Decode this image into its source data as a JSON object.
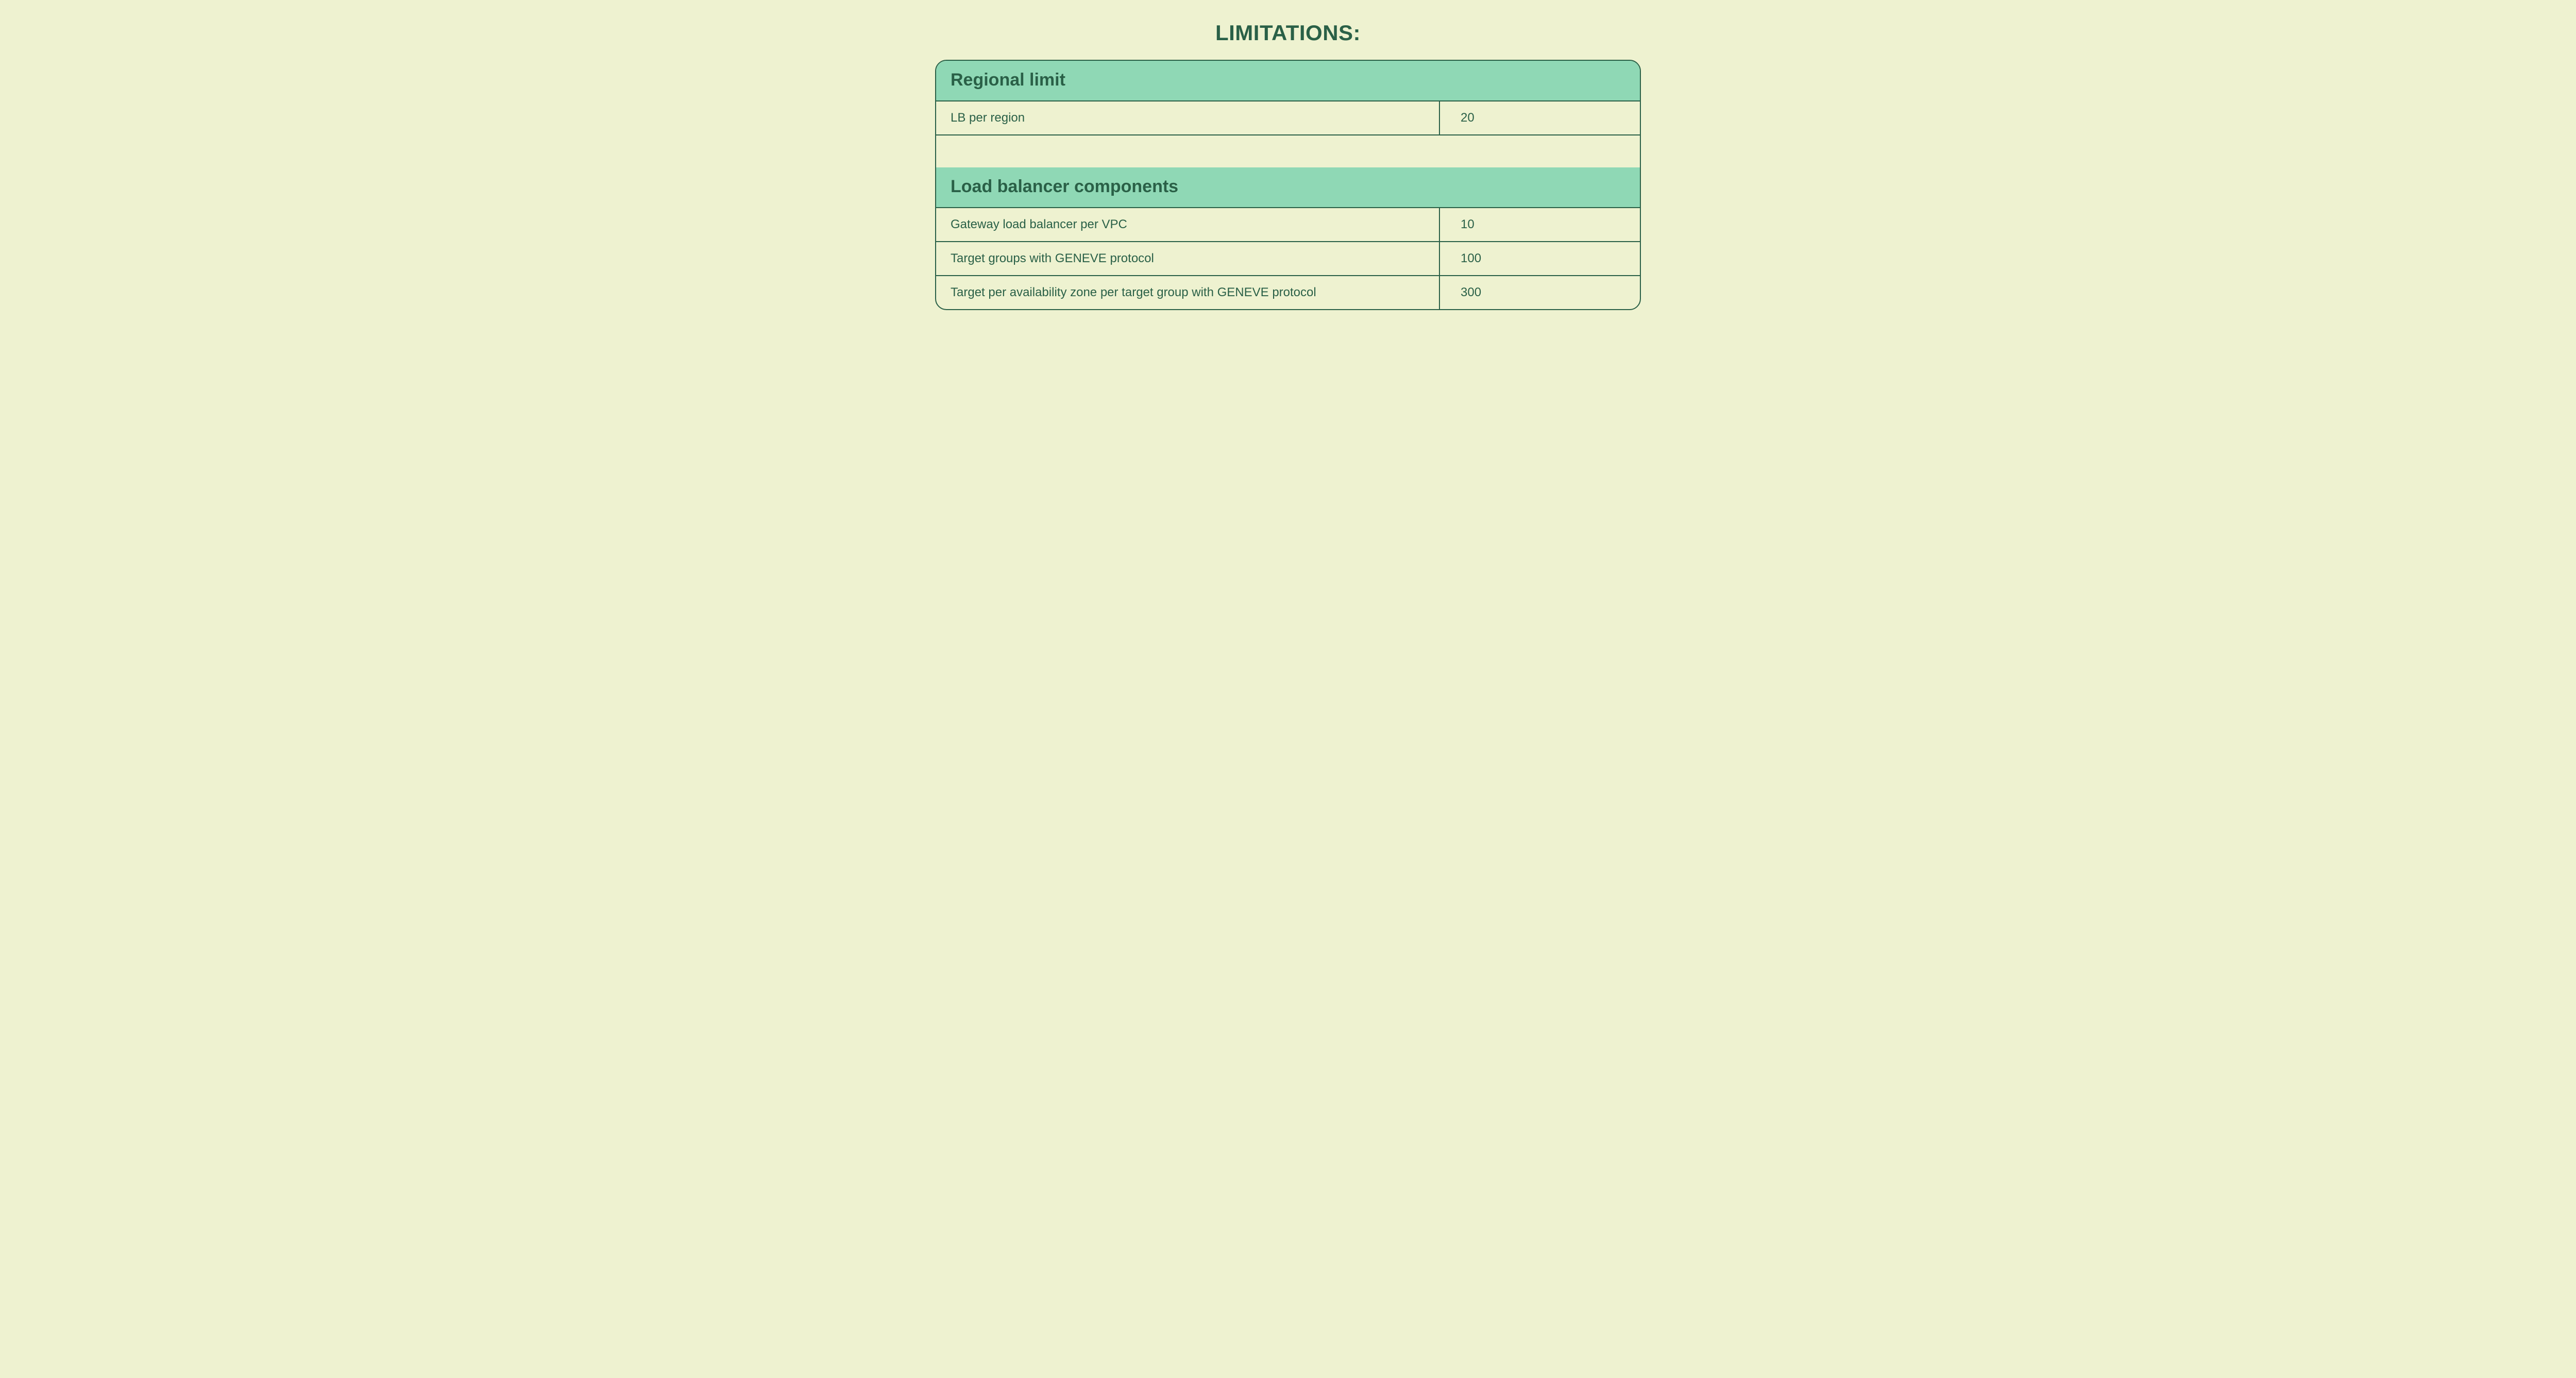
{
  "title": "LIMITATIONS:",
  "sections": [
    {
      "header": "Regional limit",
      "rows": [
        {
          "label": "LB per region",
          "value": "20"
        }
      ]
    },
    {
      "header": "Load balancer components",
      "rows": [
        {
          "label": "Gateway load balancer per VPC",
          "value": "10"
        },
        {
          "label": "Target groups with GENEVE protocol",
          "value": "100"
        },
        {
          "label": "Target per availability zone per target group with GENEVE protocol",
          "value": "300"
        }
      ]
    }
  ]
}
